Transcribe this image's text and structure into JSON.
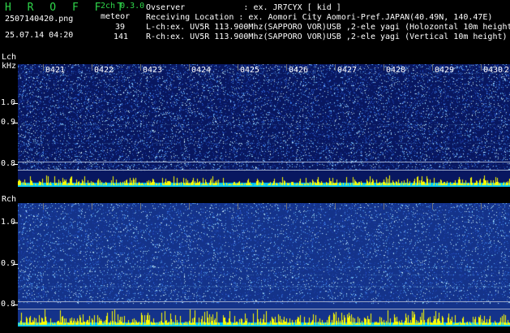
{
  "header": {
    "app_title": "H R O F F T",
    "mode": "2ch 0.3.0",
    "filename": "2507140420.png",
    "datetime": "25.07.14 04:20",
    "meteor_label": "meteor",
    "lch_count": "39",
    "rch_count": "141"
  },
  "info": {
    "observer": "Ovserver            : ex. JR7CYX [ kid ]",
    "location": "Receiving Location : ex. Aomori City Aomori-Pref.JAPAN(40.49N, 140.47E)",
    "lch": "L-ch:ex. UV5R 113.900Mhz(SAPPORO VOR)USB ,2-ele yagi (Holozontal 10m height)",
    "rch": "R-ch:ex. UV5R 113.900Mhz(SAPPORO VOR)USB ,2-ele yagi (Vertical 10m height)"
  },
  "panels": {
    "lch_label": "Lch",
    "khz_label": "kHz",
    "rch_label": "Rch",
    "lch_ticks": [
      "1.0",
      "0.9",
      "0.8"
    ],
    "rch_ticks": [
      "1.0",
      "0.9",
      "0.8"
    ],
    "minutes": [
      "0421",
      "0422",
      "0423",
      "0424",
      "0425",
      "0426",
      "0427",
      "0428",
      "0429",
      "0430"
    ],
    "edge_minute": "2"
  },
  "colors": {
    "bg": "#000000",
    "lch_bg": "#0a1a66",
    "rch_bg": "#1a3a8f",
    "header_green": "#2fd54a",
    "activity_cyan": "#00d8ff",
    "activity_yellow": "#ffff00"
  }
}
